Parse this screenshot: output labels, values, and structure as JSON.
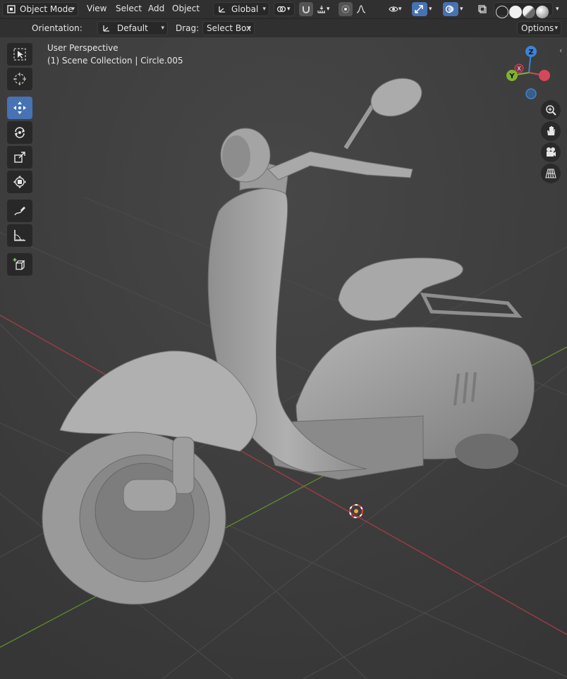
{
  "header": {
    "mode_label": "Object Mode",
    "menus": [
      "View",
      "Select",
      "Add",
      "Object"
    ],
    "transform_orientation": "Global"
  },
  "tool_header": {
    "orientation_label": "Orientation:",
    "orientation_value": "Default",
    "drag_label": "Drag:",
    "drag_value": "Select Box",
    "options_label": "Options"
  },
  "viewport": {
    "perspective_label": "User Perspective",
    "collection_label": "(1) Scene Collection | Circle.005"
  },
  "gizmo": {
    "z_label": "Z",
    "y_label": "Y",
    "x_label": "X"
  },
  "toolbar_tools": [
    "select-box-tool",
    "cursor-tool",
    "move-tool",
    "rotate-tool",
    "scale-tool",
    "transform-tool",
    "annotate-tool",
    "measure-tool",
    "add-cube-tool"
  ],
  "colors": {
    "accent": "#4772b3",
    "x_axis": "#d5485c",
    "y_axis": "#7fb234",
    "z_axis": "#3b84d8",
    "model": "#9e9e9e"
  }
}
